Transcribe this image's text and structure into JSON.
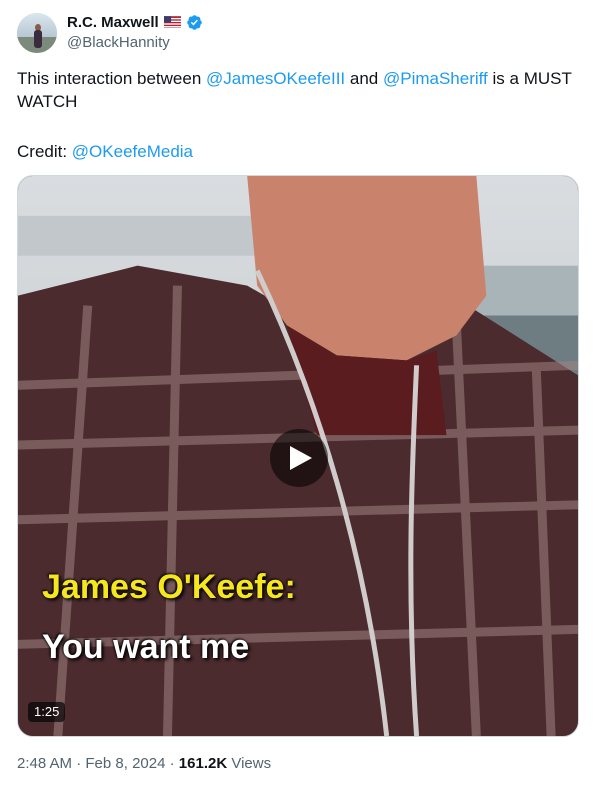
{
  "author": {
    "display_name": "R.C. Maxwell",
    "handle": "@BlackHannity",
    "flag_icon": "us-flag-icon",
    "verified_icon": "verified-badge-icon"
  },
  "tweet": {
    "text_part1": "This interaction between ",
    "mention1": "@JamesOKeefeIII",
    "text_part2": " and ",
    "mention2": "@PimaSheriff",
    "text_part3": " is a MUST WATCH",
    "credit_label": "Credit: ",
    "credit_mention": "@OKeefeMedia"
  },
  "media": {
    "caption_name": "James O'Keefe:",
    "caption_text": "You want me",
    "duration": "1:25",
    "play_icon": "play-icon"
  },
  "meta": {
    "time": "2:48 AM",
    "separator1": " · ",
    "date": "Feb 8, 2024",
    "separator2": " · ",
    "views_count": "161.2K",
    "views_label": " Views"
  },
  "colors": {
    "accent": "#1d9bf0",
    "caption_yellow": "#f5e61e",
    "secondary_text": "#536471"
  }
}
